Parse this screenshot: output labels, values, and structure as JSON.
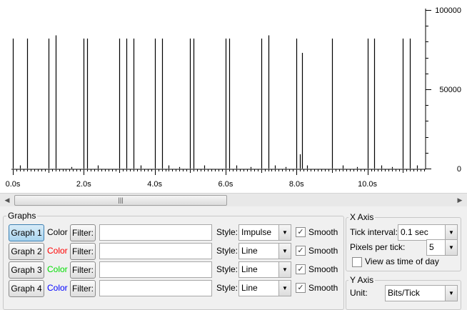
{
  "chart_data": {
    "type": "bar",
    "style": "impulse",
    "x_tick_labels": [
      "0.0s",
      "2.0s",
      "4.0s",
      "6.0s",
      "8.0s",
      "10.0s"
    ],
    "y_tick_labels": [
      "100000",
      "50000",
      "0"
    ],
    "xlim": [
      0,
      11.6
    ],
    "ylim": [
      0,
      100000
    ],
    "x": [
      0.0,
      0.2,
      0.4,
      1.0,
      1.2,
      1.65,
      2.0,
      2.1,
      2.4,
      3.0,
      3.2,
      3.4,
      3.6,
      4.0,
      4.2,
      4.4,
      4.7,
      5.0,
      5.1,
      5.4,
      6.0,
      6.1,
      6.3,
      6.7,
      7.0,
      7.2,
      7.4,
      7.7,
      8.0,
      8.1,
      8.15,
      8.3,
      9.0,
      9.3,
      9.7,
      10.0,
      10.2,
      10.4,
      10.7,
      11.0,
      11.2,
      11.4
    ],
    "values": [
      82000,
      2000,
      82000,
      82000,
      84000,
      1000,
      82000,
      82000,
      2000,
      82000,
      82000,
      82000,
      2000,
      82000,
      82000,
      2000,
      1000,
      82000,
      82000,
      2000,
      82000,
      82000,
      2000,
      1000,
      82000,
      84000,
      2000,
      1000,
      82000,
      9000,
      73000,
      2000,
      82000,
      2000,
      1000,
      82000,
      82000,
      2000,
      1000,
      82000,
      82000,
      2000
    ]
  },
  "graphs_group": {
    "title": "Graphs",
    "rows": [
      {
        "button": "Graph 1",
        "color_label": "Color",
        "color": "#000000",
        "filter_label": "Filter:",
        "filter_value": "",
        "style_label": "Style:",
        "style": "Impulse",
        "smooth_label": "Smooth",
        "smooth": true
      },
      {
        "button": "Graph 2",
        "color_label": "Color",
        "color": "#ff0000",
        "filter_label": "Filter:",
        "filter_value": "",
        "style_label": "Style:",
        "style": "Line",
        "smooth_label": "Smooth",
        "smooth": true
      },
      {
        "button": "Graph 3",
        "color_label": "Color",
        "color": "#00dd00",
        "filter_label": "Filter:",
        "filter_value": "",
        "style_label": "Style:",
        "style": "Line",
        "smooth_label": "Smooth",
        "smooth": true
      },
      {
        "button": "Graph 4",
        "color_label": "Color",
        "color": "#0000ff",
        "filter_label": "Filter:",
        "filter_value": "",
        "style_label": "Style:",
        "style": "Line",
        "smooth_label": "Smooth",
        "smooth": true
      }
    ]
  },
  "x_axis_group": {
    "title": "X Axis",
    "tick_interval_label": "Tick interval:",
    "tick_interval_value": "0.1 sec",
    "pixels_per_tick_label": "Pixels per tick:",
    "pixels_per_tick_value": "5",
    "time_of_day_label": "View as time of day",
    "time_of_day_checked": false
  },
  "y_axis_group": {
    "title": "Y Axis",
    "unit_label": "Unit:",
    "unit_value": "Bits/Tick"
  }
}
